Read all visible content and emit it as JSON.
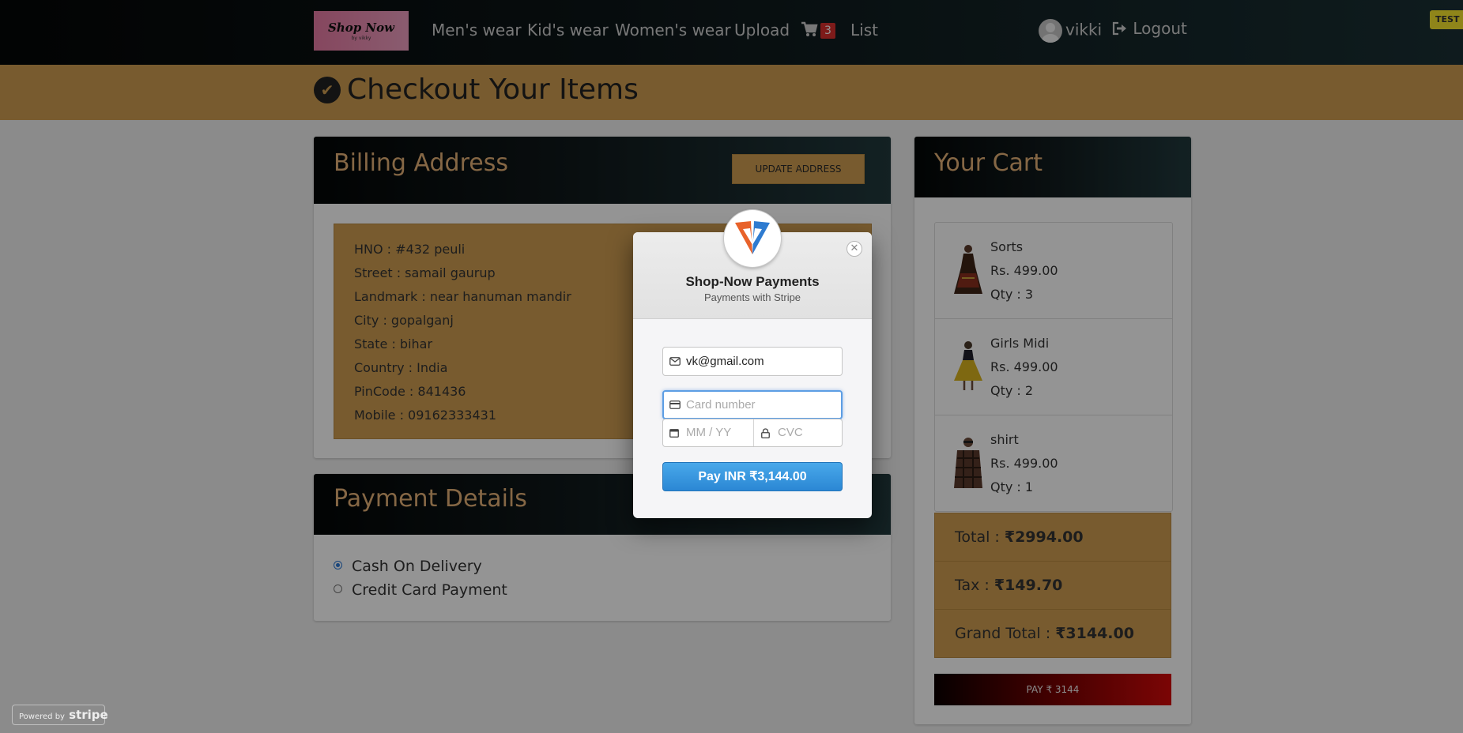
{
  "header": {
    "logo_text": "Shop Now",
    "logo_sub": "by vikky",
    "nav": [
      {
        "label": "Men's wear",
        "icon": ""
      },
      {
        "label": "Kid's wear",
        "icon": ""
      },
      {
        "label": "Women's wear",
        "icon": ""
      },
      {
        "label": "Upload",
        "icon": ""
      }
    ],
    "cart_count": "3",
    "list_label": "List",
    "username": "vikki",
    "logout_label": "Logout",
    "test_badge": "TEST MODE"
  },
  "page_title": "Checkout Your Items",
  "billing": {
    "title": "Billing Address",
    "update_label": "UPDATE ADDRESS",
    "lines": [
      "HNO : #432 peuli",
      "Street : samail gaurup",
      "Landmark : near hanuman mandir",
      "City : gopalganj",
      "State : bihar",
      "Country : India",
      "PinCode : 841436",
      "Mobile : 09162333431"
    ]
  },
  "payment": {
    "title": "Payment Details",
    "options": [
      {
        "label": "Cash On Delivery",
        "checked": true
      },
      {
        "label": "Credit Card Payment",
        "checked": false
      }
    ]
  },
  "cart": {
    "title": "Your Cart",
    "items": [
      {
        "name": "Sorts",
        "price": "Rs. 499.00",
        "qty": "Qty : 3"
      },
      {
        "name": "Girls Midi",
        "price": "Rs. 499.00",
        "qty": "Qty : 2"
      },
      {
        "name": "shirt",
        "price": "Rs. 499.00",
        "qty": "Qty : 1"
      }
    ],
    "total_label": "Total : ",
    "total_value": "₹2994.00",
    "tax_label": "Tax : ",
    "tax_value": "₹149.70",
    "grand_label": "Grand Total : ",
    "grand_value": "₹3144.00",
    "pay_label": "PAY ₹ 3144"
  },
  "stripe_modal": {
    "title": "Shop-Now Payments",
    "subtitle": "Payments with Stripe",
    "email_value": "vk@gmail.com",
    "card_placeholder": "Card number",
    "expiry_placeholder": "MM / YY",
    "cvc_placeholder": "CVC",
    "pay_label": "Pay INR ₹3,144.00"
  },
  "powered_by": {
    "prefix": "Powered by",
    "brand": "stripe"
  }
}
